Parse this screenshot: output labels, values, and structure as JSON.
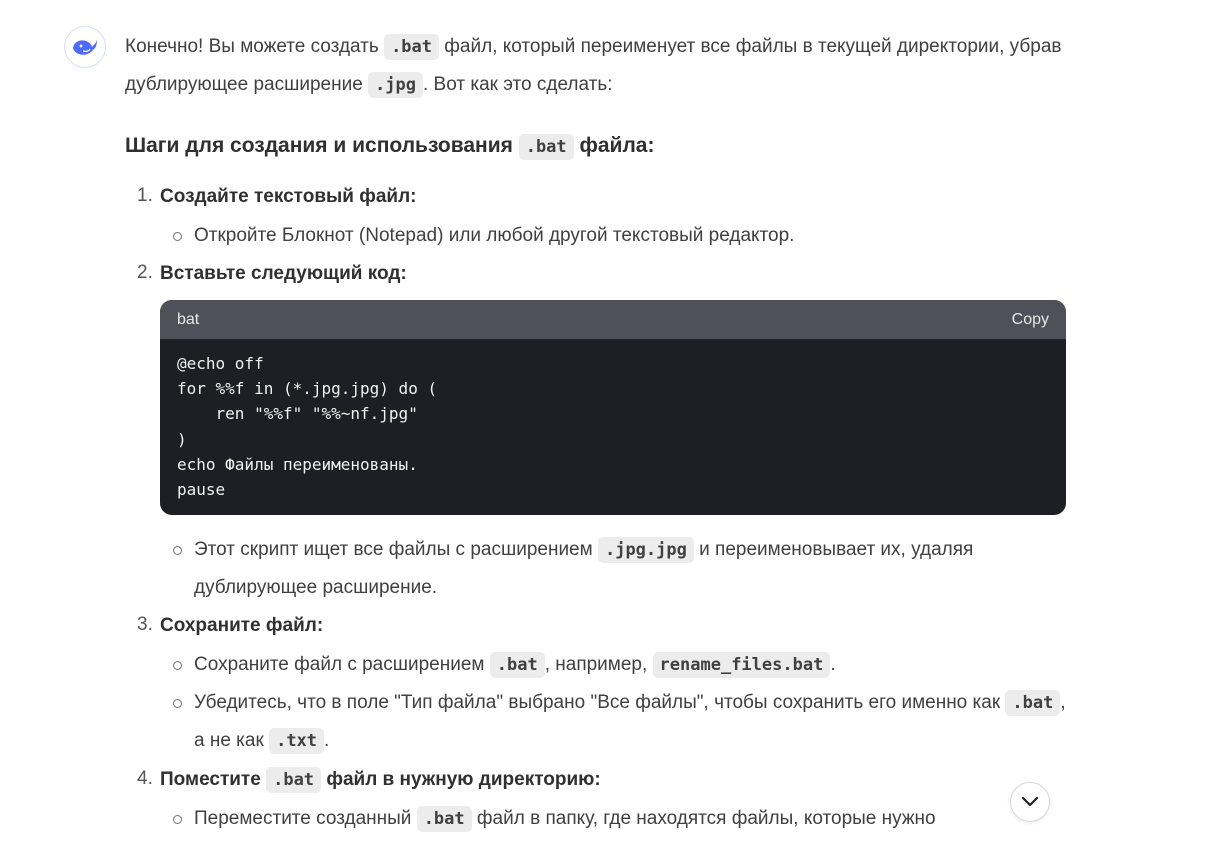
{
  "message": {
    "intro_a": "Конечно! Вы можете создать ",
    "intro_code1": ".bat",
    "intro_b": " файл, который переименует все файлы в текущей директории, убрав дублирующее расширение ",
    "intro_code2": ".jpg",
    "intro_c": ". Вот как это сделать:",
    "heading_a": "Шаги для создания и использования ",
    "heading_code": ".bat",
    "heading_b": " файла:"
  },
  "steps": [
    {
      "num": "1.",
      "title": "Создайте текстовый файл:",
      "bullets": [
        {
          "text": "Откройте Блокнот (Notepad) или любой другой текстовый редактор."
        }
      ]
    },
    {
      "num": "2.",
      "title": "Вставьте следующий код:",
      "code": {
        "lang": "bat",
        "copy_label": "Copy",
        "text": "@echo off\nfor %%f in (*.jpg.jpg) do (\n    ren \"%%f\" \"%%~nf.jpg\"\n)\necho Файлы переименованы.\npause"
      },
      "bullets": [
        {
          "a": "Этот скрипт ищет все файлы с расширением ",
          "code": ".jpg.jpg",
          "b": " и переименовывает их, удаляя дублирующее расширение."
        }
      ]
    },
    {
      "num": "3.",
      "title": "Сохраните файл:",
      "bullets": [
        {
          "a": "Сохраните файл с расширением ",
          "code1": ".bat",
          "b": ", например, ",
          "code2": "rename_files.bat",
          "c": "."
        },
        {
          "a": "Убедитесь, что в поле \"Тип файла\" выбрано \"Все файлы\", чтобы сохранить его именно как ",
          "code1": ".bat",
          "b": ", а не как ",
          "code2": ".txt",
          "c": "."
        }
      ]
    },
    {
      "num": "4.",
      "title_a": "Поместите ",
      "title_code": ".bat",
      "title_b": " файл в нужную директорию:",
      "bullets": [
        {
          "a": "Переместите созданный ",
          "code": ".bat",
          "b": " файл в папку, где находятся файлы, которые нужно"
        }
      ]
    }
  ],
  "icons": {
    "avatar": "deepseek-whale-icon",
    "scroll": "chevron-down-icon"
  },
  "colors": {
    "avatar_accent": "#4d6bfe",
    "code_header_bg": "#50505a",
    "code_body_bg": "#1e1f24",
    "inline_code_bg": "#ececec"
  }
}
